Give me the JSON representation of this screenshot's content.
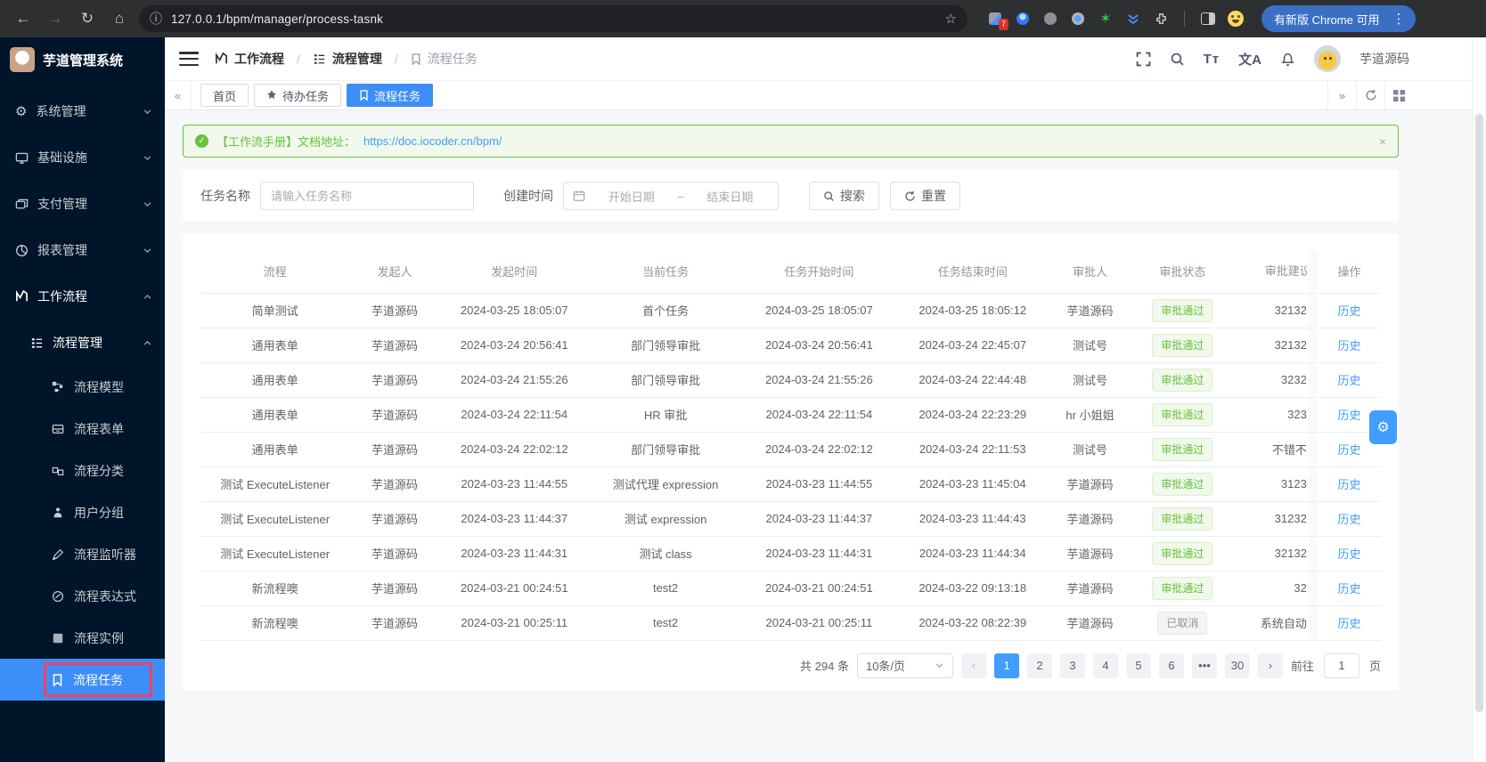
{
  "colors": {
    "primary": "#409eff",
    "sidebar_bg": "#001529",
    "active_menu_bg": "#3e8ef7",
    "annotation_red": "#f43f63",
    "success_green": "#67c23a",
    "info_gray": "#909399",
    "content_bg": "#f5f7f9",
    "chrome_bg": "#2e2f31"
  },
  "browser": {
    "url": "127.0.0.1/bpm/manager/process-tasnk",
    "update_button_label": "有新版 Chrome 可用",
    "extension_badge": "7"
  },
  "sidebar": {
    "logo_title": "芋道管理系统",
    "items": [
      {
        "label": "系统管理"
      },
      {
        "label": "基础设施"
      },
      {
        "label": "支付管理"
      },
      {
        "label": "报表管理"
      },
      {
        "label": "工作流程"
      }
    ],
    "submenu": {
      "label": "流程管理",
      "children": [
        "流程模型",
        "流程表单",
        "流程分类",
        "用户分组",
        "流程监听器",
        "流程表达式",
        "流程实例",
        "流程任务"
      ]
    }
  },
  "header": {
    "breadcrumb": [
      "工作流程",
      "流程管理",
      "流程任务"
    ],
    "username": "芋道源码"
  },
  "tabs": [
    {
      "label": "首页"
    },
    {
      "label": "待办任务"
    },
    {
      "label": "流程任务"
    }
  ],
  "banner": {
    "text": "【工作流手册】文档地址：",
    "link": "https://doc.iocoder.cn/bpm/",
    "close_label": "×"
  },
  "filters": {
    "task_name_label": "任务名称",
    "task_name_placeholder": "请输入任务名称",
    "create_time_label": "创建时间",
    "start_date_placeholder": "开始日期",
    "range_separator": "–",
    "end_date_placeholder": "结束日期",
    "search_label": "搜索",
    "reset_label": "重置"
  },
  "table": {
    "columns": [
      "流程",
      "发起人",
      "发起时间",
      "当前任务",
      "任务开始时间",
      "任务结束时间",
      "审批人",
      "审批状态",
      "审批建议",
      "操作"
    ],
    "history_label": "历史",
    "rows": [
      {
        "process": "简单测试",
        "starter": "芋道源码",
        "start_time": "2024-03-25 18:05:07",
        "current_task": "首个任务",
        "task_start": "2024-03-25 18:05:07",
        "task_end": "2024-03-25 18:05:12",
        "approver": "芋道源码",
        "status": "审批通过",
        "status_type": "success",
        "suggestion": "32132"
      },
      {
        "process": "通用表单",
        "starter": "芋道源码",
        "start_time": "2024-03-24 20:56:41",
        "current_task": "部门领导审批",
        "task_start": "2024-03-24 20:56:41",
        "task_end": "2024-03-24 22:45:07",
        "approver": "测试号",
        "status": "审批通过",
        "status_type": "success",
        "suggestion": "32132"
      },
      {
        "process": "通用表单",
        "starter": "芋道源码",
        "start_time": "2024-03-24 21:55:26",
        "current_task": "部门领导审批",
        "task_start": "2024-03-24 21:55:26",
        "task_end": "2024-03-24 22:44:48",
        "approver": "测试号",
        "status": "审批通过",
        "status_type": "success",
        "suggestion": "3232"
      },
      {
        "process": "通用表单",
        "starter": "芋道源码",
        "start_time": "2024-03-24 22:11:54",
        "current_task": "HR 审批",
        "task_start": "2024-03-24 22:11:54",
        "task_end": "2024-03-24 22:23:29",
        "approver": "hr 小姐姐",
        "status": "审批通过",
        "status_type": "success",
        "suggestion": "323"
      },
      {
        "process": "通用表单",
        "starter": "芋道源码",
        "start_time": "2024-03-24 22:02:12",
        "current_task": "部门领导审批",
        "task_start": "2024-03-24 22:02:12",
        "task_end": "2024-03-24 22:11:53",
        "approver": "测试号",
        "status": "审批通过",
        "status_type": "success",
        "suggestion": "不错不"
      },
      {
        "process": "测试 ExecuteListener",
        "starter": "芋道源码",
        "start_time": "2024-03-23 11:44:55",
        "current_task": "测试代理 expression",
        "task_start": "2024-03-23 11:44:55",
        "task_end": "2024-03-23 11:45:04",
        "approver": "芋道源码",
        "status": "审批通过",
        "status_type": "success",
        "suggestion": "3123"
      },
      {
        "process": "测试 ExecuteListener",
        "starter": "芋道源码",
        "start_time": "2024-03-23 11:44:37",
        "current_task": "测试 expression",
        "task_start": "2024-03-23 11:44:37",
        "task_end": "2024-03-23 11:44:43",
        "approver": "芋道源码",
        "status": "审批通过",
        "status_type": "success",
        "suggestion": "31232"
      },
      {
        "process": "测试 ExecuteListener",
        "starter": "芋道源码",
        "start_time": "2024-03-23 11:44:31",
        "current_task": "测试 class",
        "task_start": "2024-03-23 11:44:31",
        "task_end": "2024-03-23 11:44:34",
        "approver": "芋道源码",
        "status": "审批通过",
        "status_type": "success",
        "suggestion": "32132"
      },
      {
        "process": "新流程噢",
        "starter": "芋道源码",
        "start_time": "2024-03-21 00:24:51",
        "current_task": "test2",
        "task_start": "2024-03-21 00:24:51",
        "task_end": "2024-03-22 09:13:18",
        "approver": "芋道源码",
        "status": "审批通过",
        "status_type": "success",
        "suggestion": "32"
      },
      {
        "process": "新流程噢",
        "starter": "芋道源码",
        "start_time": "2024-03-21 00:25:11",
        "current_task": "test2",
        "task_start": "2024-03-21 00:25:11",
        "task_end": "2024-03-22 08:22:39",
        "approver": "芋道源码",
        "status": "已取消",
        "status_type": "info",
        "suggestion": "系统自动"
      }
    ]
  },
  "pagination": {
    "total": "共 294 条",
    "page_size": "10条/页",
    "pages": [
      {
        "label": "1",
        "state": "active"
      },
      {
        "label": "2",
        "state": "normal"
      },
      {
        "label": "3",
        "state": "normal"
      },
      {
        "label": "4",
        "state": "normal"
      },
      {
        "label": "5",
        "state": "normal"
      },
      {
        "label": "6",
        "state": "normal"
      },
      {
        "label": "•••",
        "state": "normal"
      },
      {
        "label": "30",
        "state": "normal"
      }
    ],
    "goto_label": "前往",
    "goto_value": "1",
    "page_unit": "页"
  }
}
